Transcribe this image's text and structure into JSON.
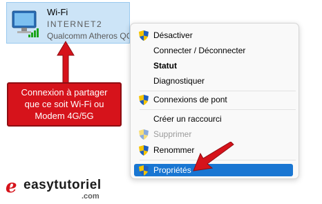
{
  "adapter": {
    "title": "Wi-Fi",
    "network": "INTERNET2",
    "device": "Qualcomm Atheros QC"
  },
  "context_menu": {
    "items": [
      {
        "label": "Désactiver",
        "shield": true
      },
      {
        "label": "Connecter / Déconnecter",
        "shield": false
      },
      {
        "label": "Statut",
        "shield": false,
        "bold": true
      },
      {
        "label": "Diagnostiquer",
        "shield": false
      },
      {
        "label": "Connexions de pont",
        "shield": true
      },
      {
        "label": "Créer un raccourci",
        "shield": false
      },
      {
        "label": "Supprimer",
        "shield": true,
        "disabled": true
      },
      {
        "label": "Renommer",
        "shield": true
      },
      {
        "label": "Propriétés",
        "shield": true,
        "selected": true
      }
    ]
  },
  "callout": {
    "line1": "Connexion à partager",
    "line2": "que ce soit Wi-Fi ou",
    "line3": "Modem 4G/5G"
  },
  "logo": {
    "mark": "e",
    "text": "easytutoriel",
    "suffix": ".com"
  },
  "colors": {
    "accent_red": "#d6131b",
    "selection_blue": "#1976d2",
    "tile_bg": "#cce4f7"
  }
}
